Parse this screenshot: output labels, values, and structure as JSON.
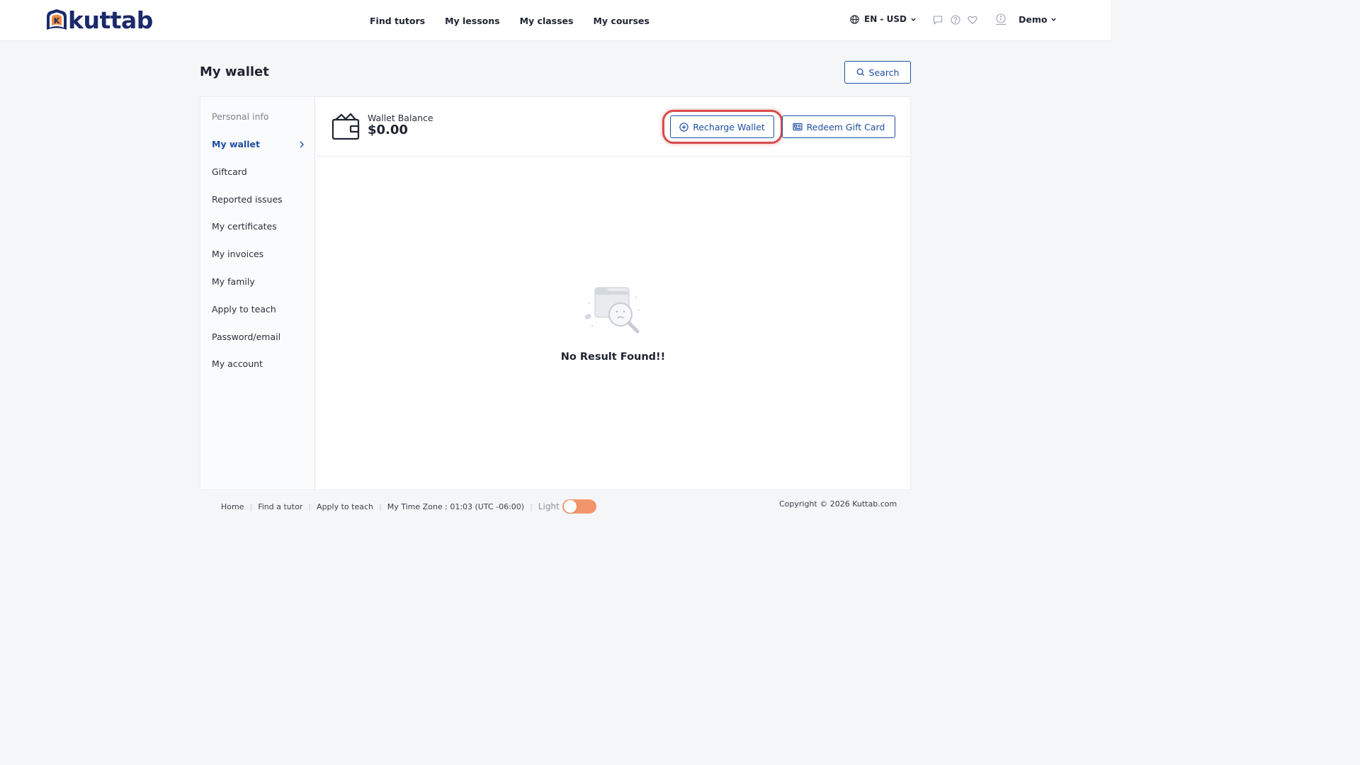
{
  "brand": {
    "name": "kuttab",
    "mark_letter": "K",
    "primary_color": "#1b2a6b",
    "accent_color": "#f08a3c"
  },
  "nav": {
    "items": [
      {
        "label": "Find tutors"
      },
      {
        "label": "My lessons"
      },
      {
        "label": "My classes"
      },
      {
        "label": "My courses"
      }
    ]
  },
  "header": {
    "language_currency": "EN - USD",
    "icons": [
      "chat-icon",
      "help-icon",
      "heart-icon",
      "info-icon"
    ],
    "user_name": "Demo"
  },
  "page": {
    "title": "My wallet",
    "search_label": "Search"
  },
  "sidebar": {
    "items": [
      {
        "label": "Personal info",
        "state": "header"
      },
      {
        "label": "My wallet",
        "state": "active"
      },
      {
        "label": "Giftcard"
      },
      {
        "label": "Reported issues"
      },
      {
        "label": "My certificates"
      },
      {
        "label": "My invoices"
      },
      {
        "label": "My family"
      },
      {
        "label": "Apply to teach"
      },
      {
        "label": "Password/email"
      },
      {
        "label": "My account"
      }
    ]
  },
  "wallet": {
    "balance_label": "Wallet Balance",
    "balance_amount": "$0.00",
    "recharge_label": "Recharge Wallet",
    "redeem_label": "Redeem Gift Card",
    "highlight_color": "#d94b4b"
  },
  "empty_state": {
    "message": "No Result Found!!"
  },
  "footer": {
    "links": [
      {
        "label": "Home"
      },
      {
        "label": "Find a tutor"
      },
      {
        "label": "Apply to teach"
      }
    ],
    "timezone": "My Time Zone : 01:03 (UTC -06:00)",
    "theme_label": "Light",
    "toggle_color": "#f3956a",
    "copyright": "Copyright © 2026 Kuttab.com"
  }
}
